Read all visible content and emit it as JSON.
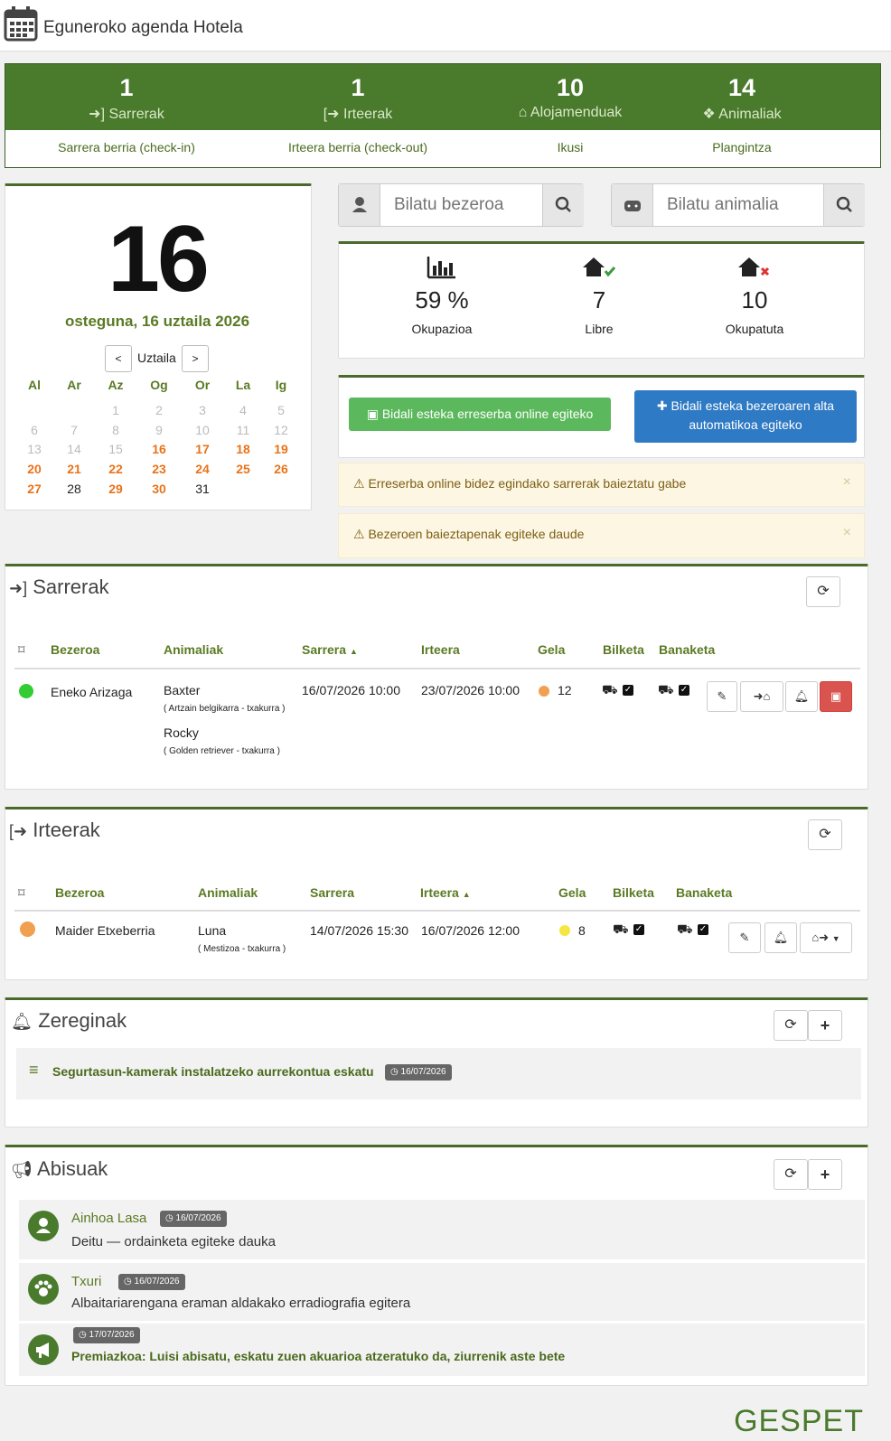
{
  "header": {
    "title": "Eguneroko agenda Hotela",
    "icon": "calendar-icon"
  },
  "stats": [
    {
      "value": "1",
      "label": "Sarrerak",
      "icon": "sign-in-icon",
      "link": "Sarrera berria (check-in)"
    },
    {
      "value": "1",
      "label": "Irteerak",
      "icon": "sign-out-icon",
      "link": "Irteera berria (check-out)"
    },
    {
      "value": "10",
      "label": "Alojamenduak",
      "icon": "home-icon",
      "link": "Ikusi"
    },
    {
      "value": "14",
      "label": "Animaliak",
      "icon": "animal-icon",
      "link": "Plangintza"
    }
  ],
  "calendar": {
    "day": "16",
    "date_line": "osteguna, 16 uztaila 2026",
    "month": "Uztaila",
    "prev": "<",
    "next": ">",
    "weekdays": [
      "Al",
      "Ar",
      "Az",
      "Og",
      "Or",
      "La",
      "Ig"
    ],
    "rows": [
      [
        {
          "d": "",
          "s": ""
        },
        {
          "d": "",
          "s": ""
        },
        {
          "d": "1",
          "s": "d"
        },
        {
          "d": "2",
          "s": "d"
        },
        {
          "d": "3",
          "s": "d"
        },
        {
          "d": "4",
          "s": "d"
        },
        {
          "d": "5",
          "s": "d"
        }
      ],
      [
        {
          "d": "6",
          "s": "d"
        },
        {
          "d": "7",
          "s": "d"
        },
        {
          "d": "8",
          "s": "d"
        },
        {
          "d": "9",
          "s": "d"
        },
        {
          "d": "10",
          "s": "d"
        },
        {
          "d": "11",
          "s": "d"
        },
        {
          "d": "12",
          "s": "d"
        }
      ],
      [
        {
          "d": "13",
          "s": "d"
        },
        {
          "d": "14",
          "s": "d"
        },
        {
          "d": "15",
          "s": "d"
        },
        {
          "d": "16",
          "s": "o"
        },
        {
          "d": "17",
          "s": "o"
        },
        {
          "d": "18",
          "s": "o"
        },
        {
          "d": "19",
          "s": "o"
        }
      ],
      [
        {
          "d": "20",
          "s": "o"
        },
        {
          "d": "21",
          "s": "o"
        },
        {
          "d": "22",
          "s": "o"
        },
        {
          "d": "23",
          "s": "o"
        },
        {
          "d": "24",
          "s": "o"
        },
        {
          "d": "25",
          "s": "o"
        },
        {
          "d": "26",
          "s": "o"
        }
      ],
      [
        {
          "d": "27",
          "s": "o"
        },
        {
          "d": "28",
          "s": "b"
        },
        {
          "d": "29",
          "s": "o"
        },
        {
          "d": "30",
          "s": "o"
        },
        {
          "d": "31",
          "s": "b"
        },
        {
          "d": "",
          "s": ""
        },
        {
          "d": "",
          "s": ""
        }
      ]
    ]
  },
  "search": {
    "client_placeholder": "Bilatu bezeroa",
    "animal_placeholder": "Bilatu animalia"
  },
  "occupancy": {
    "rate": "59 %",
    "rate_label": "Okupazioa",
    "free": "7",
    "free_label": "Libre",
    "occupied": "10",
    "occupied_label": "Okupatuta"
  },
  "actions": {
    "online_booking": "Bidali esteka erreserba online egiteko",
    "client_signup_1": "Bidali esteka bezeroaren alta",
    "client_signup_2": "automatikoa egiteko"
  },
  "alerts": [
    "Erreserba online bidez egindako sarrerak baieztatu gabe",
    "Bezeroen baieztapenak egiteke daude"
  ],
  "checkins": {
    "title": "Sarrerak",
    "columns": [
      "Bezeroa",
      "Animaliak",
      "Sarrera",
      "Irteera",
      "Gela",
      "Bilketa",
      "Banaketa"
    ],
    "row": {
      "client": "Eneko Arizaga",
      "status_color": "#33cc33",
      "animal1": "Baxter",
      "animal1_detail": "( Artzain belgikarra - txakurra )",
      "animal2": "Rocky",
      "animal2_detail": "( Golden retriever - txakurra )",
      "checkin": "16/07/2026  10:00",
      "checkout": "23/07/2026  10:00",
      "room": "12",
      "room_color": "#f0a050"
    }
  },
  "checkouts": {
    "title": "Irteerak",
    "columns": [
      "Bezeroa",
      "Animaliak",
      "Sarrera",
      "Irteera",
      "Gela",
      "Bilketa",
      "Banaketa"
    ],
    "row": {
      "client": "Maider Etxeberria",
      "status_color": "#f0a050",
      "animal1": "Luna",
      "animal1_detail": "( Mestizoa - txakurra )",
      "checkin": "14/07/2026 15:30",
      "checkout": "16/07/2026  12:00",
      "room": "8",
      "room_color": "#f5e642"
    }
  },
  "tasks": {
    "title": "Zereginak",
    "items": [
      {
        "text": "Segurtasun-kamerak instalatzeko aurrekontua eskatu",
        "date": "16/07/2026"
      }
    ]
  },
  "notices": {
    "title": "Abisuak",
    "items": [
      {
        "name": "Ainhoa Lasa",
        "date": "16/07/2026",
        "text": "Deitu — ordainketa egiteke dauka",
        "icon": "user-icon"
      },
      {
        "name": "Txuri",
        "date": "16/07/2026",
        "text": "Albaitariarengana eraman aldakako erradiografia egitera",
        "icon": "paw-icon"
      },
      {
        "name": "",
        "date": "17/07/2026",
        "text": "Premiazkoa: Luisi abisatu, eskatu zuen akuarioa atzeratuko da, ziurrenik aste bete",
        "icon": "megaphone-icon"
      }
    ]
  },
  "brand": "GESPET",
  "colors": {
    "primary": "#4a7a2c",
    "accent_orange": "#e8731a",
    "blue": "#2f7ac4",
    "green_btn": "#5cb85c",
    "danger": "#d9534f"
  }
}
